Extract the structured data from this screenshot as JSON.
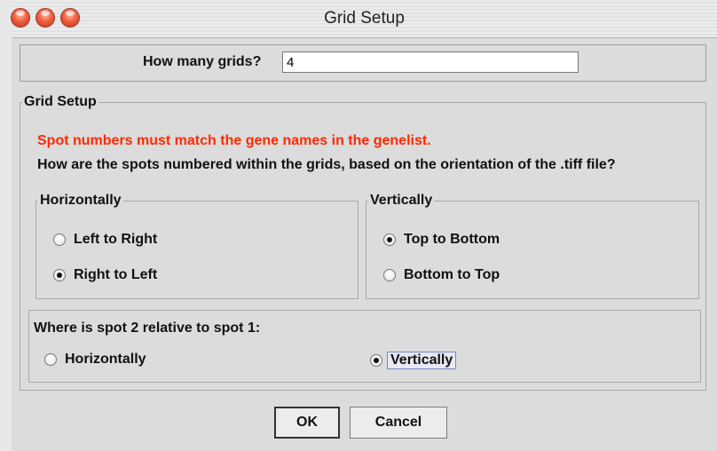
{
  "window": {
    "title": "Grid Setup"
  },
  "grid_count": {
    "label": "How many grids?",
    "value": "4"
  },
  "setup": {
    "title": "Grid Setup",
    "warning": "Spot numbers must match the gene names in the genelist.",
    "question": "How are the spots numbered within the grids, based on the orientation of the .tiff file?",
    "horizontal": {
      "title": "Horizontally",
      "options": [
        {
          "label": "Left to Right",
          "selected": false
        },
        {
          "label": "Right to Left",
          "selected": true
        }
      ]
    },
    "vertical": {
      "title": "Vertically",
      "options": [
        {
          "label": "Top to Bottom",
          "selected": true
        },
        {
          "label": "Bottom to Top",
          "selected": false
        }
      ]
    },
    "relative": {
      "question": "Where is spot 2 relative to spot 1:",
      "options": [
        {
          "label": "Horizontally",
          "selected": false
        },
        {
          "label": "Vertically",
          "selected": true
        }
      ]
    }
  },
  "buttons": {
    "ok": "OK",
    "cancel": "Cancel"
  },
  "colors": {
    "warning": "#ff2a00",
    "focus": "#7a86c8"
  }
}
